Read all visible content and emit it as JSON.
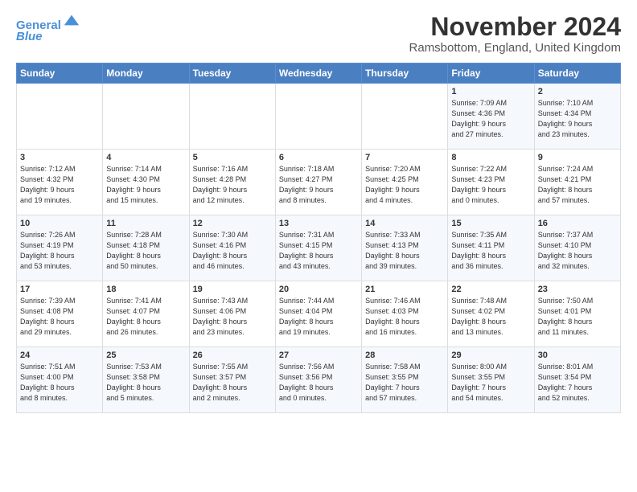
{
  "logo": {
    "line1": "General",
    "line2": "Blue"
  },
  "title": "November 2024",
  "subtitle": "Ramsbottom, England, United Kingdom",
  "weekdays": [
    "Sunday",
    "Monday",
    "Tuesday",
    "Wednesday",
    "Thursday",
    "Friday",
    "Saturday"
  ],
  "weeks": [
    [
      {
        "day": "",
        "info": ""
      },
      {
        "day": "",
        "info": ""
      },
      {
        "day": "",
        "info": ""
      },
      {
        "day": "",
        "info": ""
      },
      {
        "day": "",
        "info": ""
      },
      {
        "day": "1",
        "info": "Sunrise: 7:09 AM\nSunset: 4:36 PM\nDaylight: 9 hours\nand 27 minutes."
      },
      {
        "day": "2",
        "info": "Sunrise: 7:10 AM\nSunset: 4:34 PM\nDaylight: 9 hours\nand 23 minutes."
      }
    ],
    [
      {
        "day": "3",
        "info": "Sunrise: 7:12 AM\nSunset: 4:32 PM\nDaylight: 9 hours\nand 19 minutes."
      },
      {
        "day": "4",
        "info": "Sunrise: 7:14 AM\nSunset: 4:30 PM\nDaylight: 9 hours\nand 15 minutes."
      },
      {
        "day": "5",
        "info": "Sunrise: 7:16 AM\nSunset: 4:28 PM\nDaylight: 9 hours\nand 12 minutes."
      },
      {
        "day": "6",
        "info": "Sunrise: 7:18 AM\nSunset: 4:27 PM\nDaylight: 9 hours\nand 8 minutes."
      },
      {
        "day": "7",
        "info": "Sunrise: 7:20 AM\nSunset: 4:25 PM\nDaylight: 9 hours\nand 4 minutes."
      },
      {
        "day": "8",
        "info": "Sunrise: 7:22 AM\nSunset: 4:23 PM\nDaylight: 9 hours\nand 0 minutes."
      },
      {
        "day": "9",
        "info": "Sunrise: 7:24 AM\nSunset: 4:21 PM\nDaylight: 8 hours\nand 57 minutes."
      }
    ],
    [
      {
        "day": "10",
        "info": "Sunrise: 7:26 AM\nSunset: 4:19 PM\nDaylight: 8 hours\nand 53 minutes."
      },
      {
        "day": "11",
        "info": "Sunrise: 7:28 AM\nSunset: 4:18 PM\nDaylight: 8 hours\nand 50 minutes."
      },
      {
        "day": "12",
        "info": "Sunrise: 7:30 AM\nSunset: 4:16 PM\nDaylight: 8 hours\nand 46 minutes."
      },
      {
        "day": "13",
        "info": "Sunrise: 7:31 AM\nSunset: 4:15 PM\nDaylight: 8 hours\nand 43 minutes."
      },
      {
        "day": "14",
        "info": "Sunrise: 7:33 AM\nSunset: 4:13 PM\nDaylight: 8 hours\nand 39 minutes."
      },
      {
        "day": "15",
        "info": "Sunrise: 7:35 AM\nSunset: 4:11 PM\nDaylight: 8 hours\nand 36 minutes."
      },
      {
        "day": "16",
        "info": "Sunrise: 7:37 AM\nSunset: 4:10 PM\nDaylight: 8 hours\nand 32 minutes."
      }
    ],
    [
      {
        "day": "17",
        "info": "Sunrise: 7:39 AM\nSunset: 4:08 PM\nDaylight: 8 hours\nand 29 minutes."
      },
      {
        "day": "18",
        "info": "Sunrise: 7:41 AM\nSunset: 4:07 PM\nDaylight: 8 hours\nand 26 minutes."
      },
      {
        "day": "19",
        "info": "Sunrise: 7:43 AM\nSunset: 4:06 PM\nDaylight: 8 hours\nand 23 minutes."
      },
      {
        "day": "20",
        "info": "Sunrise: 7:44 AM\nSunset: 4:04 PM\nDaylight: 8 hours\nand 19 minutes."
      },
      {
        "day": "21",
        "info": "Sunrise: 7:46 AM\nSunset: 4:03 PM\nDaylight: 8 hours\nand 16 minutes."
      },
      {
        "day": "22",
        "info": "Sunrise: 7:48 AM\nSunset: 4:02 PM\nDaylight: 8 hours\nand 13 minutes."
      },
      {
        "day": "23",
        "info": "Sunrise: 7:50 AM\nSunset: 4:01 PM\nDaylight: 8 hours\nand 11 minutes."
      }
    ],
    [
      {
        "day": "24",
        "info": "Sunrise: 7:51 AM\nSunset: 4:00 PM\nDaylight: 8 hours\nand 8 minutes."
      },
      {
        "day": "25",
        "info": "Sunrise: 7:53 AM\nSunset: 3:58 PM\nDaylight: 8 hours\nand 5 minutes."
      },
      {
        "day": "26",
        "info": "Sunrise: 7:55 AM\nSunset: 3:57 PM\nDaylight: 8 hours\nand 2 minutes."
      },
      {
        "day": "27",
        "info": "Sunrise: 7:56 AM\nSunset: 3:56 PM\nDaylight: 8 hours\nand 0 minutes."
      },
      {
        "day": "28",
        "info": "Sunrise: 7:58 AM\nSunset: 3:55 PM\nDaylight: 7 hours\nand 57 minutes."
      },
      {
        "day": "29",
        "info": "Sunrise: 8:00 AM\nSunset: 3:55 PM\nDaylight: 7 hours\nand 54 minutes."
      },
      {
        "day": "30",
        "info": "Sunrise: 8:01 AM\nSunset: 3:54 PM\nDaylight: 7 hours\nand 52 minutes."
      }
    ]
  ],
  "colors": {
    "header_bg": "#4a7fc1",
    "odd_row": "#f5f8fc",
    "even_row": "#ffffff"
  }
}
